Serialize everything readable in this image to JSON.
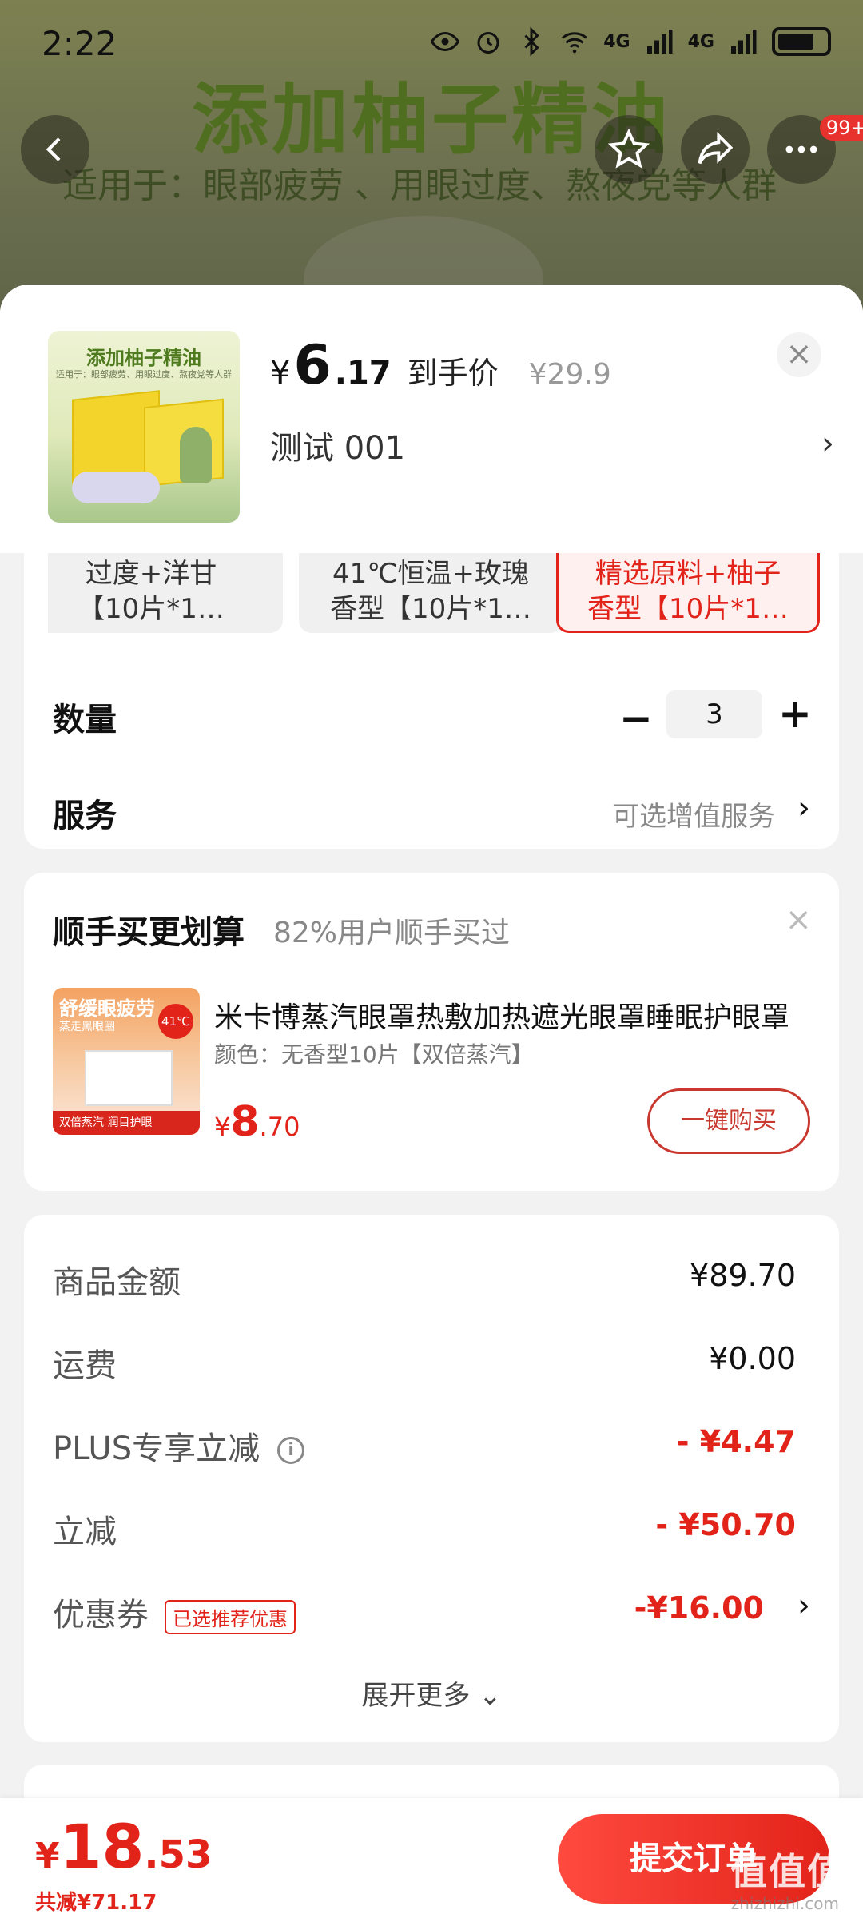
{
  "status_bar": {
    "time": "2:22",
    "net1": "4G",
    "net2": "4G"
  },
  "banner": {
    "title": "添加柚子精油",
    "subtitle": "适用于：眼部疲劳 、用眼过度、熬夜党等人群"
  },
  "nav": {
    "badge": "99+"
  },
  "product": {
    "thumb_title": "添加柚子精油",
    "thumb_sub": "适用于：眼部疲劳、用眼过度、熬夜党等人群",
    "price_yen": "¥",
    "price_int": "6",
    "price_dec": ".17",
    "price_label": "到手价",
    "orig_price": "¥29.9",
    "spec": "测试  001"
  },
  "variants": [
    {
      "line1": "过度+洋甘",
      "line2": "【10片*1…"
    },
    {
      "line1": "41℃恒温+玫瑰",
      "line2": "香型【10片*1…"
    },
    {
      "line1": "精选原料+柚子",
      "line2": "香型【10片*1…"
    }
  ],
  "quantity": {
    "label": "数量",
    "value": "3",
    "minus": "−",
    "plus": "+"
  },
  "service": {
    "label": "服务",
    "value": "可选增值服务"
  },
  "bundle": {
    "title": "顺手买更划算",
    "subtitle": "82%用户顺手买过",
    "thumb_title": "舒缓眼疲劳",
    "thumb_sub": "蒸走黑眼圈",
    "thumb_deg": "41℃",
    "thumb_foot": "双倍蒸汽 润目护眼",
    "name": "米卡博蒸汽眼罩热敷加热遮光眼罩睡眠护眼罩",
    "spec": "颜色：无香型10片【双倍蒸汽】",
    "price_yen": "¥",
    "price_int": "8",
    "price_dec": ".70",
    "buy_label": "一键购买"
  },
  "amounts": {
    "goods_label": "商品金额",
    "goods_value": "¥89.70",
    "shipping_label": "运费",
    "shipping_value": "¥0.00",
    "plus_label": "PLUS专享立减",
    "plus_value": "- ¥4.47",
    "cut_label": "立减",
    "cut_value": "- ¥50.70",
    "coupon_label": "优惠券",
    "coupon_tag": "已选推荐优惠",
    "coupon_value": "-¥16.00",
    "expand_label": "展开更多"
  },
  "footer": {
    "total_yen": "¥",
    "total_int": "18",
    "total_dec": ".53",
    "saved": "共减¥71.17",
    "submit_label": "提交订单",
    "watermark": "值值值",
    "watermark_url": "zhizhizhi.com"
  }
}
